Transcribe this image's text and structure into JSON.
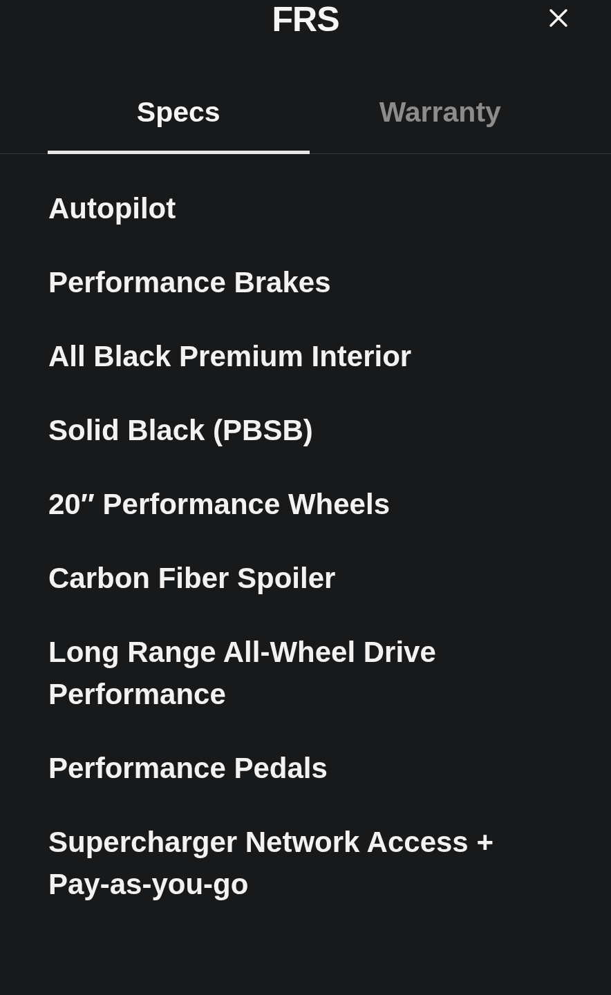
{
  "title": "FRS",
  "tabs": [
    {
      "label": "Specs",
      "selected": true
    },
    {
      "label": "Warranty",
      "selected": false
    }
  ],
  "specs": [
    "Autopilot",
    "Performance Brakes",
    "All Black Premium Interior",
    "Solid Black (PBSB)",
    "20″ Performance Wheels",
    "Carbon Fiber Spoiler",
    "Long Range All-Wheel Drive Performance",
    "Performance Pedals",
    "Supercharger Network Access + Pay-as-you-go"
  ]
}
